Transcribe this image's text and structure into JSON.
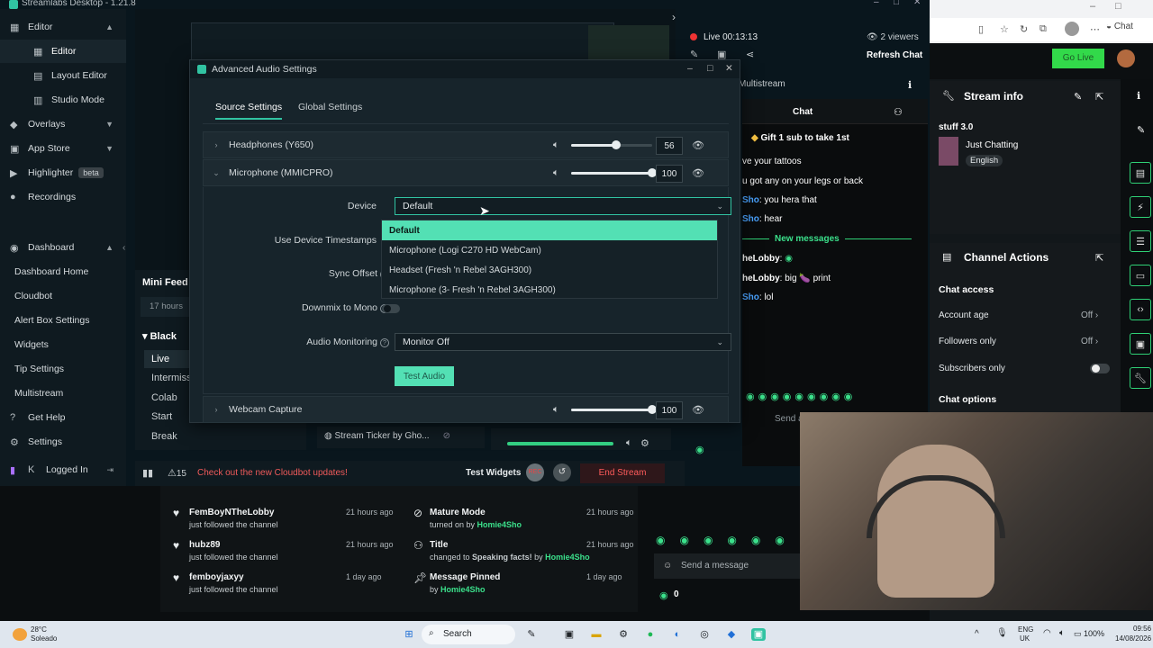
{
  "app": {
    "title": "Streamlabs Desktop - 1.21.8"
  },
  "nav": {
    "editor": "Editor",
    "editor_sub": "Editor",
    "layout_editor": "Layout Editor",
    "studio_mode": "Studio Mode",
    "overlays": "Overlays",
    "app_store": "App Store",
    "highlighter": "Highlighter",
    "highlighter_badge": "beta",
    "recordings": "Recordings",
    "dashboard": "Dashboard",
    "dashboard_home": "Dashboard Home",
    "cloudbot": "Cloudbot",
    "alert_box": "Alert Box Settings",
    "widgets": "Widgets",
    "tip_settings": "Tip Settings",
    "multistream": "Multistream",
    "get_help": "Get Help",
    "settings": "Settings",
    "logged_in": "Logged In"
  },
  "dialog": {
    "title": "Advanced Audio Settings",
    "tabs": [
      "Source Settings",
      "Global Settings"
    ],
    "sources": [
      {
        "name": "Headphones (Y650)",
        "volume": "56",
        "level": 0.55
      },
      {
        "name": "Microphone (MMICPRO)",
        "volume": "100",
        "level": 1.0
      },
      {
        "name": "Webcam Capture",
        "volume": "100",
        "level": 1.0
      }
    ],
    "device_label": "Device",
    "device_value": "Default",
    "device_options": [
      "Default",
      "Microphone (Logi C270 HD WebCam)",
      "Headset (Fresh 'n Rebel 3AGH300)",
      "Microphone (3- Fresh 'n Rebel 3AGH300)"
    ],
    "use_device_timestamps": "Use Device Timestamps",
    "sync_offset": "Sync Offset",
    "downmix": "Downmix to Mono",
    "audio_monitoring": "Audio Monitoring",
    "monitoring_value": "Monitor Off",
    "test_audio": "Test Audio"
  },
  "stream": {
    "live_time": "Live 00:13:13",
    "viewers": "2 viewers",
    "refresh_chat": "Refresh Chat",
    "multistream": "Multistream",
    "chat_title": "Chat",
    "gift_banner": "Gift 1 sub to take 1st",
    "new_messages": "New messages",
    "send_message": "Send a message",
    "messages": [
      {
        "text": "ve your tattoos"
      },
      {
        "text": "u got any on your legs or back"
      },
      {
        "user": "Sho",
        "text": ": you hera that"
      },
      {
        "user": "Sho",
        "text": ": hear"
      },
      {
        "user": "heLobby",
        "text": ":"
      },
      {
        "user": "heLobby",
        "text": ": big 🍆 print"
      },
      {
        "user": "Sho",
        "text": ": lol"
      }
    ]
  },
  "browser": {
    "go_live": "Go Live"
  },
  "stream_info": {
    "title": "Stream info",
    "stream_title": "stuff 3.0",
    "category": "Just Chatting",
    "language": "English"
  },
  "channel_actions": {
    "title": "Channel Actions",
    "chat_access": "Chat access",
    "account_age": "Account age",
    "account_age_value": "Off",
    "followers_only": "Followers only",
    "followers_only_value": "Off",
    "subscribers_only": "Subscribers only",
    "chat_options": "Chat options"
  },
  "mini_feed": {
    "title": "Mini Feed",
    "filter": "17 hours",
    "scene_header": "Black",
    "scenes": [
      "Live",
      "Intermiss",
      "Colab",
      "Start",
      "Break"
    ],
    "ticker": "Stream Ticker by Gho..."
  },
  "footer": {
    "alert_count": "15",
    "cloudbot_notice": "Check out the new Cloudbot updates!",
    "test_widgets": "Test Widgets",
    "end_stream": "End Stream"
  },
  "activity": [
    {
      "name": "FemBoyNTheLobby",
      "sub": "just followed the channel",
      "time": "21 hours ago"
    },
    {
      "name": "hubz89",
      "sub": "just followed the channel",
      "time": "21 hours ago"
    },
    {
      "name": "femboyjaxyy",
      "sub": "just followed the channel",
      "time": "1 day ago"
    },
    {
      "name": "Mature Mode",
      "sub": "turned on by ",
      "user": "Homie4Sho",
      "time": "21 hours ago"
    },
    {
      "name": "Title",
      "sub": "changed to ",
      "sub_bold": "Speaking facts!",
      "by": " by ",
      "user": "Homie4Sho",
      "time": "21 hours ago"
    },
    {
      "name": "Message Pinned",
      "sub": "by ",
      "user": "Homie4Sho",
      "time": "1 day ago"
    }
  ],
  "obs_chat": {
    "send_message": "Send a message",
    "count": "0"
  },
  "taskbar": {
    "temp": "28°C",
    "weather": "Soleado",
    "search": "Search",
    "lang": "ENG",
    "region": "UK",
    "battery": "100%",
    "time": "09:56",
    "date": "14/08/2026"
  },
  "colors": {
    "accent": "#31c3a2",
    "dropdown_selected": "#53e0b4",
    "end_stream": "#e04a4a",
    "go_live": "#32d94a"
  }
}
